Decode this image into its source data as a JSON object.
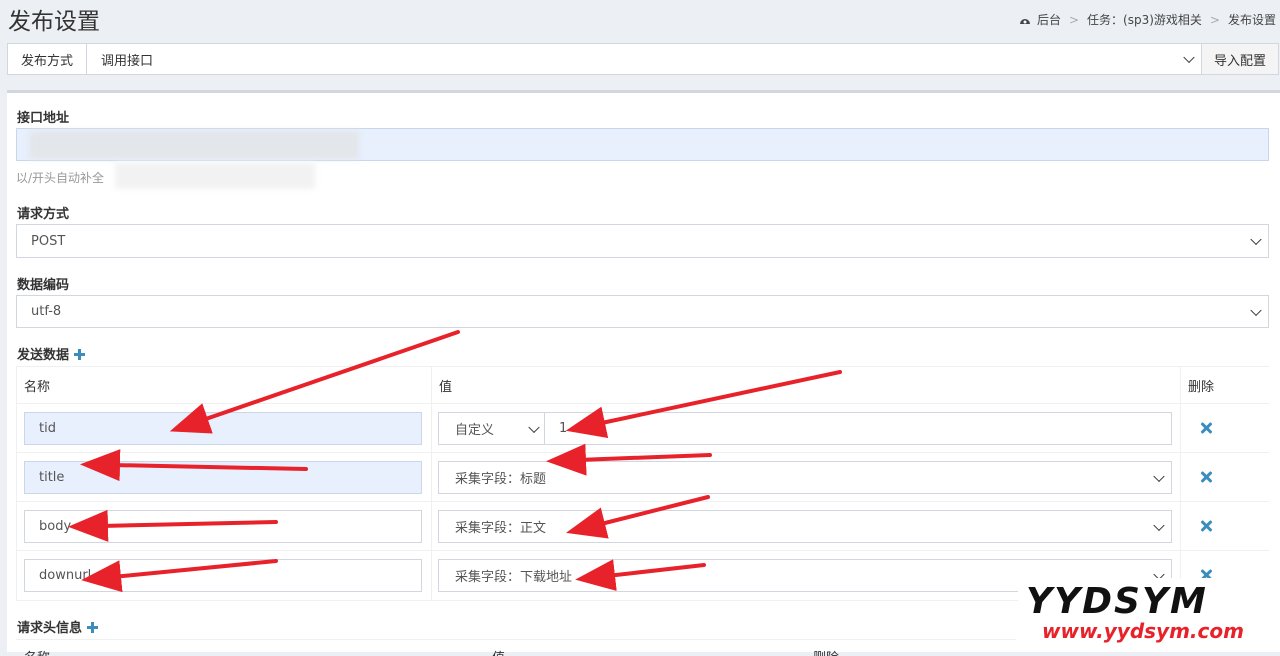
{
  "header": {
    "title": "发布设置",
    "breadcrumb": [
      "后台",
      "任务：(sp3)游戏相关",
      "发布设置"
    ]
  },
  "method_bar": {
    "label": "发布方式",
    "value": "调用接口",
    "import_button": "导入配置"
  },
  "form": {
    "api_url_label": "接口地址",
    "api_url_help": "以/开头自动补全",
    "request_method_label": "请求方式",
    "request_method_value": "POST",
    "encoding_label": "数据编码",
    "encoding_value": "utf-8",
    "send_data_label": "发送数据",
    "headers_label": "请求头信息"
  },
  "send_table": {
    "columns": [
      "名称",
      "值",
      "删除"
    ],
    "rows": [
      {
        "name": "tid",
        "value_type": "自定义",
        "value": "1"
      },
      {
        "name": "title",
        "value": "采集字段：标题"
      },
      {
        "name": "body",
        "value": "采集字段：正文"
      },
      {
        "name": "downurl",
        "value": "采集字段：下载地址"
      }
    ]
  },
  "headers_table": {
    "columns": [
      "名称",
      "值",
      "删除"
    ]
  },
  "watermark": {
    "brand": "YYDSYM",
    "url": "www.yydsym.com",
    "color": "#e8222a"
  },
  "colors": {
    "accent": "#3c8dbc",
    "arrow": "#e8222a",
    "highlight": "#e8f0fe"
  }
}
